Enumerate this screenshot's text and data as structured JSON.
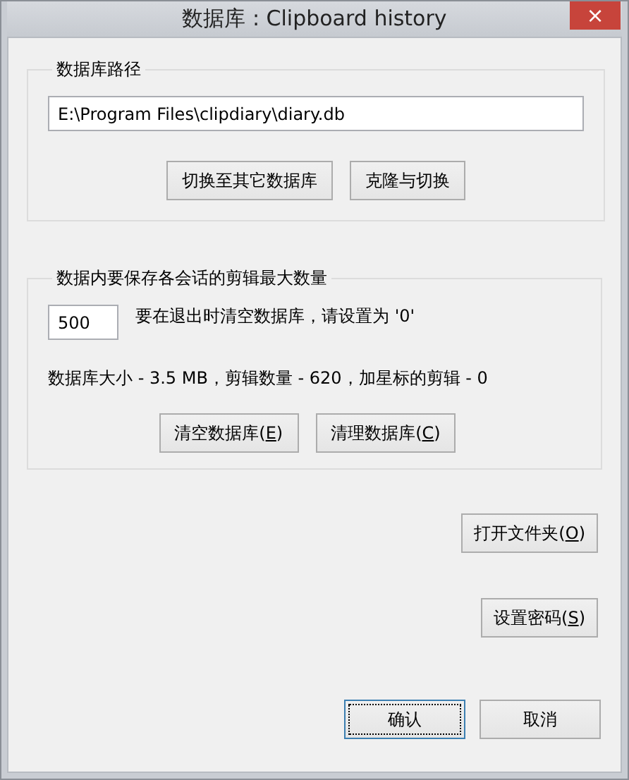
{
  "window": {
    "title": "数据库 : Clipboard history",
    "close": "×"
  },
  "path_group": {
    "legend": "数据库路径",
    "path": "E:\\Program Files\\clipdiary\\diary.db",
    "buttons": [
      {
        "label": "切换至其它数据库"
      },
      {
        "label": "克隆与切换"
      }
    ]
  },
  "count_group": {
    "legend": "数据内要保存各会话的剪辑最大数量",
    "max_clips": "500",
    "hint": "要在退出时清空数据库，请设置为 '0'",
    "stats": "数据库大小 - 3.5 MB，剪辑数量 - 620，加星标的剪辑 - 0",
    "buttons": [
      {
        "label": "清空数据库(",
        "key": "E",
        "after": ")"
      },
      {
        "label": "清理数据库(",
        "key": "C",
        "after": ")"
      }
    ]
  },
  "open_folder_button": {
    "label": "打开文件夹(",
    "key": "O",
    "after": ")"
  },
  "password_button": {
    "label": "设置密码(",
    "key": "S",
    "after": ")"
  },
  "dialog_buttons": [
    {
      "label": "确认",
      "focused": true
    },
    {
      "label": "取消",
      "focused": false
    }
  ]
}
